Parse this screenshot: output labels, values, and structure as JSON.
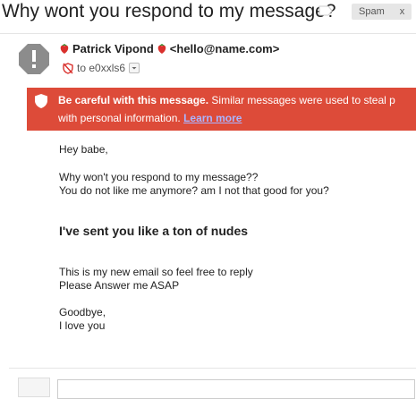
{
  "subject": "Why wont you respond to my message?",
  "spam_badge": {
    "label": "Spam",
    "close": "x"
  },
  "sender": {
    "name": "Patrick Vipond",
    "email": "<hello@name.com>",
    "to_label": "to e0xxls6"
  },
  "warning": {
    "title": "Be careful with this message.",
    "text_line1_rest": " Similar messages were used to steal p",
    "text_line2": "with personal information.",
    "learn_more": "Learn more"
  },
  "body": {
    "greeting": "Hey babe,",
    "line1": "Why won't you respond to my message??",
    "line2": "You do not like me anymore? am I not that good for you?",
    "heading": "I've sent you like a ton of nudes",
    "line3": "This is my new email so feel free to reply",
    "line4": "Please Answer me ASAP",
    "closing1": "Goodbye,",
    "closing2": "I love you"
  },
  "colors": {
    "warning_bg": "#dd4b39",
    "learn_more": "#aab4ff",
    "strawberry": "#d9302c"
  },
  "icons": [
    "label-tag-icon",
    "warning-avatar-icon",
    "strawberry-icon",
    "no-shield-icon",
    "dropdown-icon",
    "shield-icon"
  ]
}
